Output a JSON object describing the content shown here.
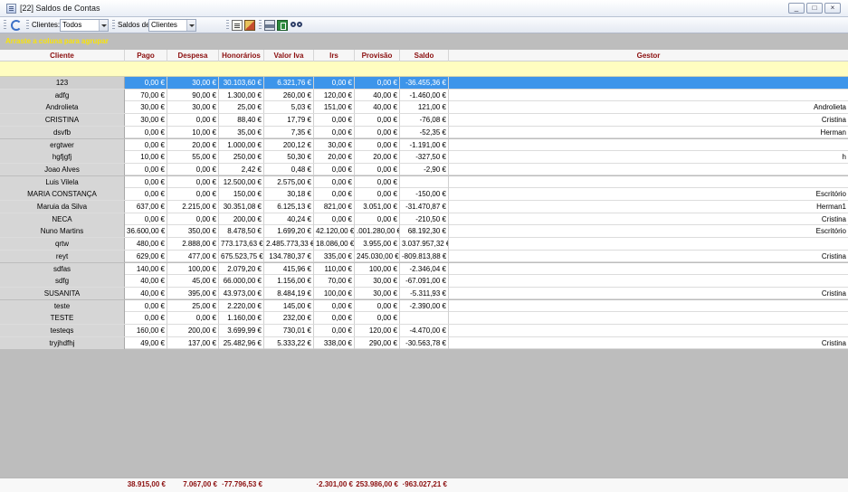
{
  "window": {
    "title": "[22] Saldos de Contas",
    "min_label": "_",
    "max_label": "□",
    "close_label": "×"
  },
  "toolbar": {
    "clients_label": "Clientes:",
    "clients_value": "Todos",
    "saldos_label": "Saldos de",
    "saldos_value": "Clientes"
  },
  "group_panel": {
    "text": "Arraste a coluna para agrupar"
  },
  "columns": [
    "Cliente",
    "Pago",
    "Despesa",
    "Honorários",
    "Valor Iva",
    "Irs",
    "Provisão",
    "Saldo",
    "Gestor"
  ],
  "rows": [
    {
      "cliente": "123",
      "pago": "0,00 €",
      "despesa": "30,00 €",
      "honorarios": "30.103,60 €",
      "iva": "6.321,76 €",
      "irs": "0,00 €",
      "provisao": "0,00 €",
      "saldo": "-36.455,36 €",
      "gestor": ""
    },
    {
      "cliente": "adfg",
      "pago": "70,00 €",
      "despesa": "90,00 €",
      "honorarios": "1.300,00 €",
      "iva": "260,00 €",
      "irs": "120,00 €",
      "provisao": "40,00 €",
      "saldo": "-1.460,00 €",
      "gestor": ""
    },
    {
      "cliente": "Androlieta",
      "pago": "30,00 €",
      "despesa": "30,00 €",
      "honorarios": "25,00 €",
      "iva": "5,03 €",
      "irs": "151,00 €",
      "provisao": "40,00 €",
      "saldo": "121,00 €",
      "gestor": "Androlieta"
    },
    {
      "cliente": "CRISTINA",
      "pago": "30,00 €",
      "despesa": "0,00 €",
      "honorarios": "88,40 €",
      "iva": "17,79 €",
      "irs": "0,00 €",
      "provisao": "0,00 €",
      "saldo": "-76,08 €",
      "gestor": "Cristina"
    },
    {
      "cliente": "dsvfb",
      "pago": "0,00 €",
      "despesa": "10,00 €",
      "honorarios": "35,00 €",
      "iva": "7,35 €",
      "irs": "0,00 €",
      "provisao": "0,00 €",
      "saldo": "-52,35 €",
      "gestor": "Herman"
    },
    {
      "cliente": "ergtwer",
      "pago": "0,00 €",
      "despesa": "20,00 €",
      "honorarios": "1.000,00 €",
      "iva": "200,12 €",
      "irs": "30,00 €",
      "provisao": "0,00 €",
      "saldo": "-1.191,00 €",
      "gestor": ""
    },
    {
      "cliente": "hgfjgfj",
      "pago": "10,00 €",
      "despesa": "55,00 €",
      "honorarios": "250,00 €",
      "iva": "50,30 €",
      "irs": "20,00 €",
      "provisao": "20,00 €",
      "saldo": "-327,50 €",
      "gestor": "h"
    },
    {
      "cliente": "Joao Alves",
      "pago": "0,00 €",
      "despesa": "0,00 €",
      "honorarios": "2,42 €",
      "iva": "0,48 €",
      "irs": "0,00 €",
      "provisao": "0,00 €",
      "saldo": "-2,90 €",
      "gestor": ""
    },
    {
      "cliente": "Luis Vilela",
      "pago": "0,00 €",
      "despesa": "0,00 €",
      "honorarios": "12.500,00 €",
      "iva": "2.575,00 €",
      "irs": "0,00 €",
      "provisao": "0,00 €",
      "saldo": "",
      "gestor": ""
    },
    {
      "cliente": "MARIA CONSTANÇA",
      "pago": "0,00 €",
      "despesa": "0,00 €",
      "honorarios": "150,00 €",
      "iva": "30,18 €",
      "irs": "0,00 €",
      "provisao": "0,00 €",
      "saldo": "-150,00 €",
      "gestor": "Escritório"
    },
    {
      "cliente": "Maruia da Silva",
      "pago": "637,00 €",
      "despesa": "2.215,00 €",
      "honorarios": "30.351,08 €",
      "iva": "6.125,13 €",
      "irs": "821,00 €",
      "provisao": "3.051,00 €",
      "saldo": "-31.470,87 €",
      "gestor": "Herman1"
    },
    {
      "cliente": "NECA",
      "pago": "0,00 €",
      "despesa": "0,00 €",
      "honorarios": "200,00 €",
      "iva": "40,24 €",
      "irs": "0,00 €",
      "provisao": "0,00 €",
      "saldo": "-210,50 €",
      "gestor": "Cristina"
    },
    {
      "cliente": "Nuno Martins",
      "pago": "36.600,00 €",
      "despesa": "350,00 €",
      "honorarios": "8.478,50 €",
      "iva": "1.699,20 €",
      "irs": "42.120,00 €",
      "provisao": ".001.280,00 €",
      "saldo": "68.192,30 €",
      "gestor": "Escritório"
    },
    {
      "cliente": "qrtw",
      "pago": "480,00 €",
      "despesa": "2.888,00 €",
      "honorarios": "773.173,63 €",
      "iva": "2.485.773,33 €",
      "irs": "18.086,00 €",
      "provisao": "3.955,00 €",
      "saldo": "3.037.957,32 €",
      "gestor": ""
    },
    {
      "cliente": "reyt",
      "pago": "629,00 €",
      "despesa": "477,00 €",
      "honorarios": "675.523,75 €",
      "iva": "134.780,37 €",
      "irs": "335,00 €",
      "provisao": "245.030,00 €",
      "saldo": "-809.813,88 €",
      "gestor": "Cristina"
    },
    {
      "cliente": "sdfas",
      "pago": "140,00 €",
      "despesa": "100,00 €",
      "honorarios": "2.079,20 €",
      "iva": "415,96 €",
      "irs": "110,00 €",
      "provisao": "100,00 €",
      "saldo": "-2.346,04 €",
      "gestor": ""
    },
    {
      "cliente": "sdfg",
      "pago": "40,00 €",
      "despesa": "45,00 €",
      "honorarios": "66.000,00 €",
      "iva": "1.156,00 €",
      "irs": "70,00 €",
      "provisao": "30,00 €",
      "saldo": "-67.091,00 €",
      "gestor": ""
    },
    {
      "cliente": "SUSANITA",
      "pago": "40,00 €",
      "despesa": "395,00 €",
      "honorarios": "43.973,00 €",
      "iva": "8.484,19 €",
      "irs": "100,00 €",
      "provisao": "30,00 €",
      "saldo": "-5.311,93 €",
      "gestor": "Cristina"
    },
    {
      "cliente": "teste",
      "pago": "0,00 €",
      "despesa": "25,00 €",
      "honorarios": "2.220,00 €",
      "iva": "145,00 €",
      "irs": "0,00 €",
      "provisao": "0,00 €",
      "saldo": "-2.390,00 €",
      "gestor": ""
    },
    {
      "cliente": "TESTE",
      "pago": "0,00 €",
      "despesa": "0,00 €",
      "honorarios": "1.160,00 €",
      "iva": "232,00 €",
      "irs": "0,00 €",
      "provisao": "0,00 €",
      "saldo": "",
      "gestor": ""
    },
    {
      "cliente": "testeqs",
      "pago": "160,00 €",
      "despesa": "200,00 €",
      "honorarios": "3.699,99 €",
      "iva": "730,01 €",
      "irs": "0,00 €",
      "provisao": "120,00 €",
      "saldo": "-4.470,00 €",
      "gestor": ""
    },
    {
      "cliente": "tryjhdfhj",
      "pago": "49,00 €",
      "despesa": "137,00 €",
      "honorarios": "25.482,96 €",
      "iva": "5.333,22 €",
      "irs": "338,00 €",
      "provisao": "290,00 €",
      "saldo": "-30.563,78 €",
      "gestor": "Cristina"
    }
  ],
  "totals": {
    "pago": "38.915,00 €",
    "despesa": "7.067,00 €",
    "honorarios": "·77.796,53 €",
    "irs": "·2.301,00 €",
    "provisao": "253.986,00 €",
    "saldo": "·963.027,21 €"
  },
  "colors": {
    "header_text": "#8b0e0e",
    "group_text": "#f8e30a",
    "selected_row": "#3d95ea",
    "filter_row": "#fffdc0",
    "empty_area": "#bdbdbd"
  }
}
